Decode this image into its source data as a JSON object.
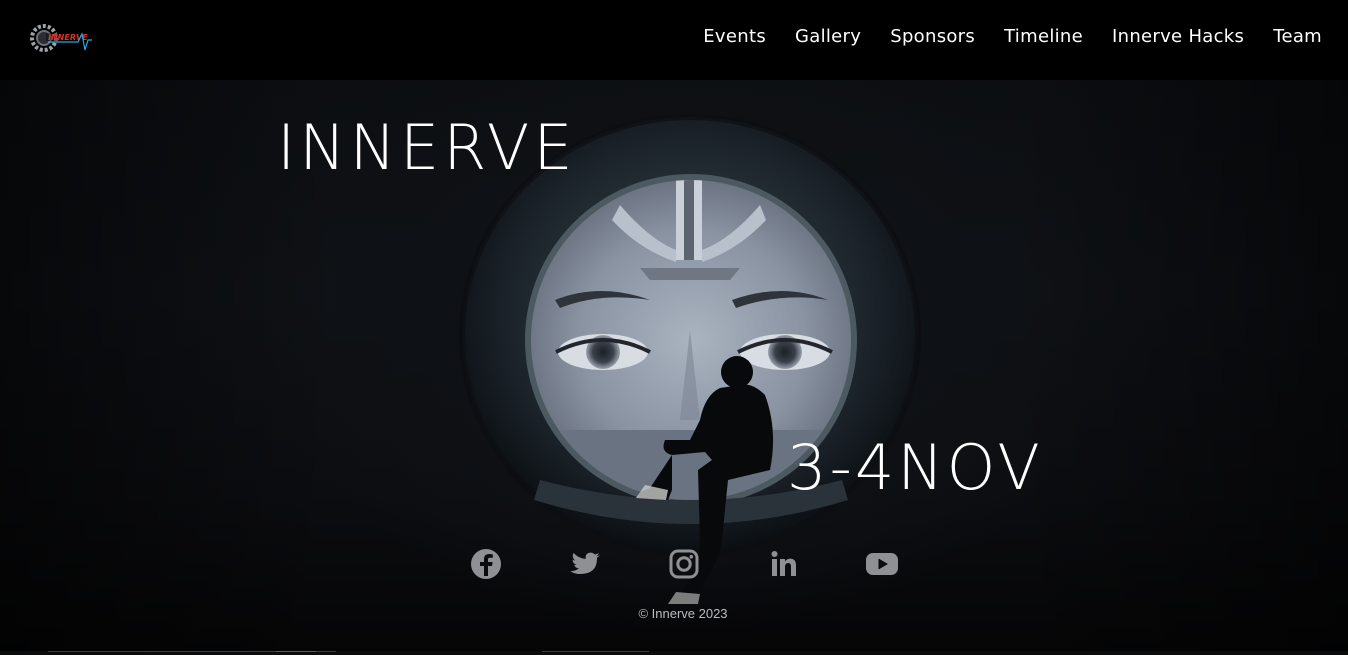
{
  "brand": {
    "logo_icon": "innerve-gear-logo",
    "logo_text": "INNERVE"
  },
  "nav": {
    "items": [
      {
        "label": "Events"
      },
      {
        "label": "Gallery"
      },
      {
        "label": "Sponsors"
      },
      {
        "label": "Timeline"
      },
      {
        "label": "Innerve Hacks"
      },
      {
        "label": "Team"
      }
    ]
  },
  "hero": {
    "title": "INNERVE",
    "date": "3-4NOV",
    "image": "portal-with-face-and-seated-person"
  },
  "social": {
    "icons": [
      "facebook-icon",
      "twitter-icon",
      "instagram-icon",
      "linkedin-icon",
      "youtube-icon"
    ],
    "icon_color": "#8e9094"
  },
  "footer": {
    "copyright": "© Innerve 2023"
  },
  "colors": {
    "background": "#070809",
    "navbar": "#000000",
    "text": "#ffffff",
    "logo_accent": "#e0312f",
    "logo_line": "#2aa8e0"
  }
}
